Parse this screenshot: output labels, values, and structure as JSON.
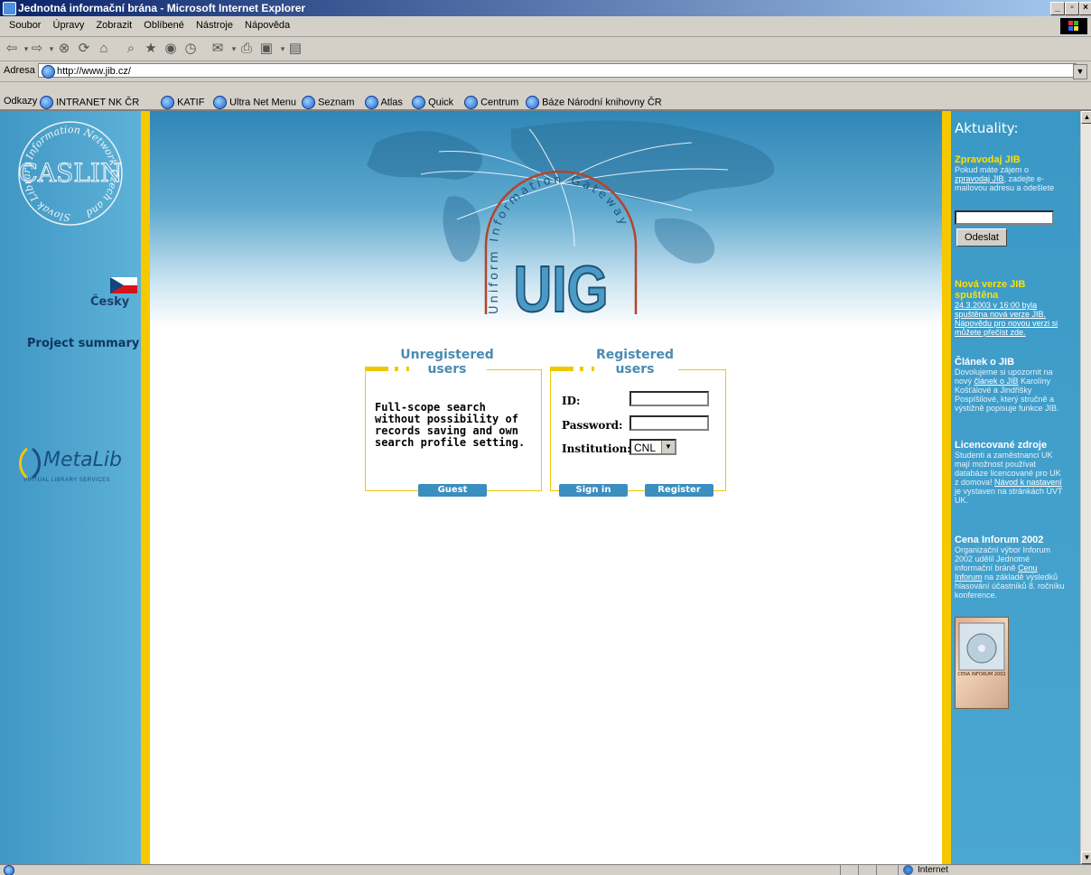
{
  "window": {
    "title": "Jednotná informační brána - Microsoft Internet Explorer"
  },
  "menu": [
    "Soubor",
    "Úpravy",
    "Zobrazit",
    "Oblíbené",
    "Nástroje",
    "Nápověda"
  ],
  "address": {
    "label": "Adresa",
    "url": "http://www.jib.cz/"
  },
  "links": {
    "label": "Odkazy",
    "items": [
      "INTRANET NK ČR",
      "KATIF",
      "Ultra Net Menu",
      "Seznam",
      "Atlas",
      "Quick",
      "Centrum",
      "Báze Národní knihovny ČR"
    ]
  },
  "left": {
    "seal": {
      "ring_text": "Slovak Library Information Network Czech and",
      "center": "CASLIN"
    },
    "lang_link": "Česky",
    "project_summary": "Project summary",
    "metalib": {
      "logo": "MetaLib",
      "sub": "VIRTUAL LIBRARY SERVICES"
    }
  },
  "banner": {
    "arc_text": "Uniform Information Gateway",
    "logo": "UIG"
  },
  "unregistered": {
    "title_line1": "Unregistered",
    "title_line2": "users",
    "description": "Full-scope search without possibility of records saving and own search profile setting.",
    "guest_button": "Guest"
  },
  "registered": {
    "title_line1": "Registered",
    "title_line2": "users",
    "id_label": "ID:",
    "password_label": "Password:",
    "institution_label": "Institution:",
    "institution_value": "CNL",
    "signin_button": "Sign in",
    "register_button": "Register"
  },
  "news": {
    "heading": "Aktuality:",
    "zpravodaj": {
      "title": "Zpravodaj JIB",
      "text1": "Pokud máte zájem o",
      "link": "zpravodaj JIB",
      "text2": ", zadejte e-mailovou adresu a odešlete",
      "button": "Odeslat"
    },
    "verze": {
      "title": "Nová verze JIB spuštěna",
      "text": "24.3.2003 v 16:00 byla spuštěna nová verze JIB. Nápovědu pro novou verzi si můžete přečíst zde."
    },
    "clanek": {
      "title": "Článek o JIB",
      "text1": "Dovolujeme si upozornit na nový",
      "link": "článek o JIB",
      "text2": "Karolíny Košťálové a Jindřišky Pospíšilové, který stručně a výstižně popisuje funkce JIB."
    },
    "zdroje": {
      "title": "Licencované zdroje",
      "text1": "Studenti a zaměstnanci UK mají možnost používat databáze licencované pro UK z domova!",
      "link": "Návod k nastavení",
      "text2": "je vystaven na stránkách ÚVT UK."
    },
    "cena": {
      "title": "Cena Inforum 2002",
      "text1": "Organizační výbor Inforum 2002 udělil Jednotné informační bráně",
      "link": "Cenu Inforum",
      "text2": "na základě výsledků hlasování účastníků 8. ročníku konference.",
      "image_label": "CENA INFORUM 2002"
    }
  },
  "status": {
    "zone": "Internet"
  },
  "colors": {
    "side_blue": "#4a9ec9",
    "stripe_yellow": "#f5c800",
    "title_blue": "#4a8bb2",
    "button_blue": "#3a8ec0"
  }
}
